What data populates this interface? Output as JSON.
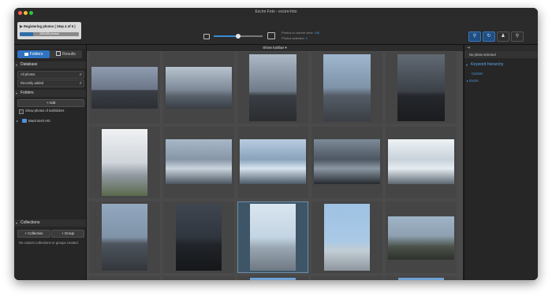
{
  "window": {
    "title": "Excire Foto - excire-foto"
  },
  "toolbar": {
    "progress_label": "Registering photos ( Step 4 of 5 )",
    "progress_count": "105/456 photos",
    "progress_fraction": 0.23,
    "thumb_size_fraction": 0.5,
    "photos_in_view_label": "Photos in current view:",
    "photos_in_view_value": "456",
    "photos_selected_label": "Photos selected:",
    "photos_selected_value": "0",
    "show_toolbar_label": "Show toolbar"
  },
  "sidebar": {
    "tab_folders": "Folders",
    "tab_results": "Results",
    "database_heading": "Database",
    "database_select": "All photos",
    "sort_select": "Recently added",
    "folders_heading": "Folders",
    "add_label": "+ Add",
    "show_subfolders": "Show photos of subfolders",
    "folder_item": "Macintosh HD",
    "collections_heading": "Collections",
    "collection_button": "+ Collection",
    "group_button": "+ Group",
    "no_collections": "No custom collections or groups created."
  },
  "right_panel": {
    "status": "No photo selected",
    "heading": "Keyword hierarchy",
    "item_custom": "Custom",
    "item_excire": "Excire"
  },
  "colors": {
    "accent": "#2f73c0",
    "link": "#4f9be0",
    "selected_cell": "#3e5568"
  },
  "icons": [
    "folder-icon",
    "small-thumbnail-icon",
    "large-thumbnail-icon",
    "tag-icon",
    "refresh-icon",
    "people-icon",
    "search-icon"
  ]
}
